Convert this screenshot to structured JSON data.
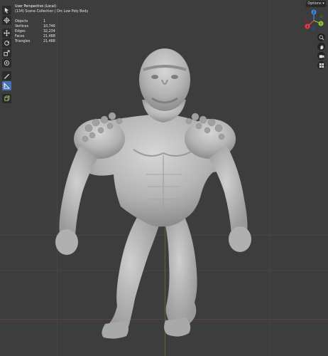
{
  "viewport": {
    "title": "User Perspective (Local)",
    "collection": "(134) Scene Collection | Orc Low Poly Body",
    "stats": [
      {
        "label": "Objects",
        "value": "1"
      },
      {
        "label": "Vertices",
        "value": "10,746"
      },
      {
        "label": "Edges",
        "value": "32,234"
      },
      {
        "label": "Faces",
        "value": "21,488"
      },
      {
        "label": "Triangles",
        "value": "21,488"
      }
    ]
  },
  "header": {
    "options_label": "Options"
  },
  "gizmo": {
    "x_label": "X",
    "y_label": "Y",
    "z_label": "Z"
  },
  "toolbar": {
    "tools": [
      "select-tool-icon",
      "cursor-tool-icon",
      "move-tool-icon",
      "rotate-tool-icon",
      "scale-tool-icon",
      "transform-tool-icon",
      "annotate-tool-icon",
      "measure-tool-icon",
      "add-cube-icon"
    ],
    "active_index": 7
  },
  "nav": [
    "zoom-icon",
    "hand-pan-icon",
    "camera-icon",
    "grid-view-icon"
  ],
  "colors": {
    "background": "#3d3d3d",
    "model": "#bdbdbd",
    "accent": "#4772b3",
    "x_axis": "#e5414e",
    "y_axis": "#8fc43a",
    "z_axis": "#3d8be6"
  }
}
